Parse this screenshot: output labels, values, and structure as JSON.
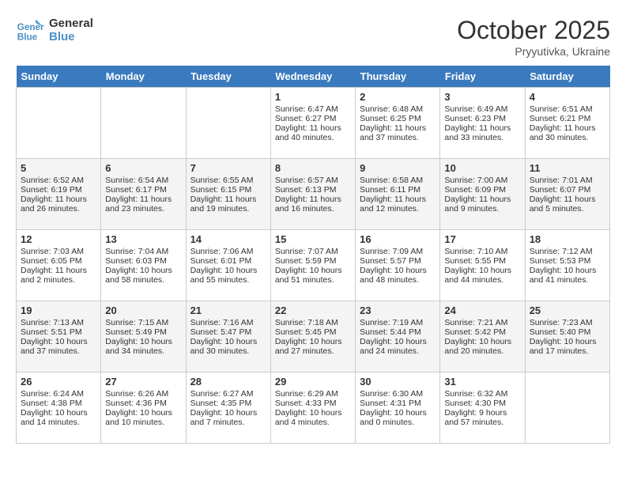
{
  "header": {
    "logo_line1": "General",
    "logo_line2": "Blue",
    "month": "October 2025",
    "location": "Pryyutivka, Ukraine"
  },
  "days_of_week": [
    "Sunday",
    "Monday",
    "Tuesday",
    "Wednesday",
    "Thursday",
    "Friday",
    "Saturday"
  ],
  "weeks": [
    [
      {
        "day": "",
        "empty": true
      },
      {
        "day": "",
        "empty": true
      },
      {
        "day": "",
        "empty": true
      },
      {
        "day": "1",
        "sunrise": "6:47 AM",
        "sunset": "6:27 PM",
        "daylight": "11 hours and 40 minutes."
      },
      {
        "day": "2",
        "sunrise": "6:48 AM",
        "sunset": "6:25 PM",
        "daylight": "11 hours and 37 minutes."
      },
      {
        "day": "3",
        "sunrise": "6:49 AM",
        "sunset": "6:23 PM",
        "daylight": "11 hours and 33 minutes."
      },
      {
        "day": "4",
        "sunrise": "6:51 AM",
        "sunset": "6:21 PM",
        "daylight": "11 hours and 30 minutes."
      }
    ],
    [
      {
        "day": "5",
        "sunrise": "6:52 AM",
        "sunset": "6:19 PM",
        "daylight": "11 hours and 26 minutes."
      },
      {
        "day": "6",
        "sunrise": "6:54 AM",
        "sunset": "6:17 PM",
        "daylight": "11 hours and 23 minutes."
      },
      {
        "day": "7",
        "sunrise": "6:55 AM",
        "sunset": "6:15 PM",
        "daylight": "11 hours and 19 minutes."
      },
      {
        "day": "8",
        "sunrise": "6:57 AM",
        "sunset": "6:13 PM",
        "daylight": "11 hours and 16 minutes."
      },
      {
        "day": "9",
        "sunrise": "6:58 AM",
        "sunset": "6:11 PM",
        "daylight": "11 hours and 12 minutes."
      },
      {
        "day": "10",
        "sunrise": "7:00 AM",
        "sunset": "6:09 PM",
        "daylight": "11 hours and 9 minutes."
      },
      {
        "day": "11",
        "sunrise": "7:01 AM",
        "sunset": "6:07 PM",
        "daylight": "11 hours and 5 minutes."
      }
    ],
    [
      {
        "day": "12",
        "sunrise": "7:03 AM",
        "sunset": "6:05 PM",
        "daylight": "11 hours and 2 minutes."
      },
      {
        "day": "13",
        "sunrise": "7:04 AM",
        "sunset": "6:03 PM",
        "daylight": "10 hours and 58 minutes."
      },
      {
        "day": "14",
        "sunrise": "7:06 AM",
        "sunset": "6:01 PM",
        "daylight": "10 hours and 55 minutes."
      },
      {
        "day": "15",
        "sunrise": "7:07 AM",
        "sunset": "5:59 PM",
        "daylight": "10 hours and 51 minutes."
      },
      {
        "day": "16",
        "sunrise": "7:09 AM",
        "sunset": "5:57 PM",
        "daylight": "10 hours and 48 minutes."
      },
      {
        "day": "17",
        "sunrise": "7:10 AM",
        "sunset": "5:55 PM",
        "daylight": "10 hours and 44 minutes."
      },
      {
        "day": "18",
        "sunrise": "7:12 AM",
        "sunset": "5:53 PM",
        "daylight": "10 hours and 41 minutes."
      }
    ],
    [
      {
        "day": "19",
        "sunrise": "7:13 AM",
        "sunset": "5:51 PM",
        "daylight": "10 hours and 37 minutes."
      },
      {
        "day": "20",
        "sunrise": "7:15 AM",
        "sunset": "5:49 PM",
        "daylight": "10 hours and 34 minutes."
      },
      {
        "day": "21",
        "sunrise": "7:16 AM",
        "sunset": "5:47 PM",
        "daylight": "10 hours and 30 minutes."
      },
      {
        "day": "22",
        "sunrise": "7:18 AM",
        "sunset": "5:45 PM",
        "daylight": "10 hours and 27 minutes."
      },
      {
        "day": "23",
        "sunrise": "7:19 AM",
        "sunset": "5:44 PM",
        "daylight": "10 hours and 24 minutes."
      },
      {
        "day": "24",
        "sunrise": "7:21 AM",
        "sunset": "5:42 PM",
        "daylight": "10 hours and 20 minutes."
      },
      {
        "day": "25",
        "sunrise": "7:23 AM",
        "sunset": "5:40 PM",
        "daylight": "10 hours and 17 minutes."
      }
    ],
    [
      {
        "day": "26",
        "sunrise": "6:24 AM",
        "sunset": "4:38 PM",
        "daylight": "10 hours and 14 minutes."
      },
      {
        "day": "27",
        "sunrise": "6:26 AM",
        "sunset": "4:36 PM",
        "daylight": "10 hours and 10 minutes."
      },
      {
        "day": "28",
        "sunrise": "6:27 AM",
        "sunset": "4:35 PM",
        "daylight": "10 hours and 7 minutes."
      },
      {
        "day": "29",
        "sunrise": "6:29 AM",
        "sunset": "4:33 PM",
        "daylight": "10 hours and 4 minutes."
      },
      {
        "day": "30",
        "sunrise": "6:30 AM",
        "sunset": "4:31 PM",
        "daylight": "10 hours and 0 minutes."
      },
      {
        "day": "31",
        "sunrise": "6:32 AM",
        "sunset": "4:30 PM",
        "daylight": "9 hours and 57 minutes."
      },
      {
        "day": "",
        "empty": true
      }
    ]
  ]
}
